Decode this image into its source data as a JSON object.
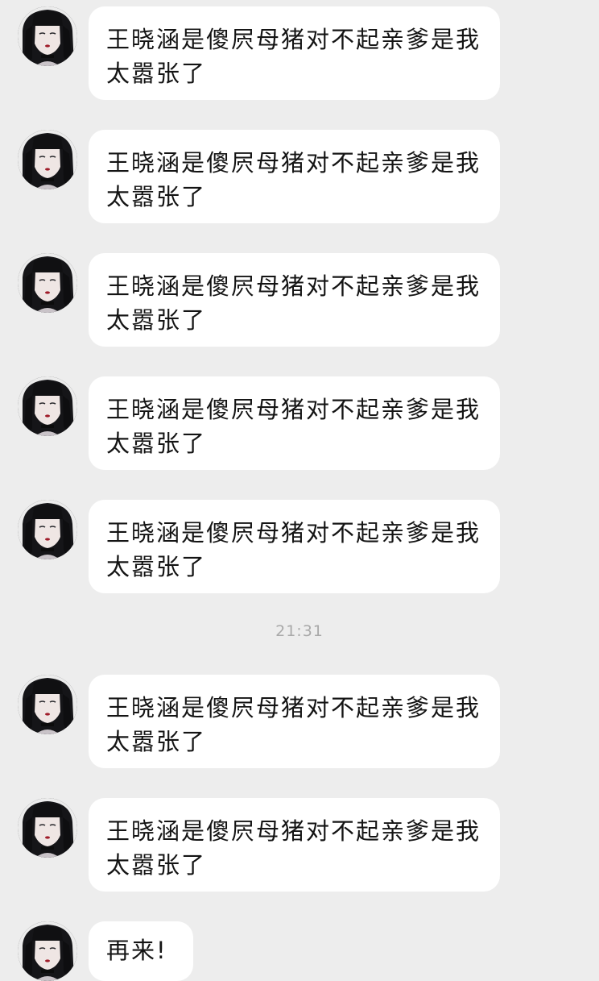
{
  "messages_before": [
    {
      "text": "王晓涵是傻屄母猪对不起亲爹是我太嚣张了"
    },
    {
      "text": "王晓涵是傻屄母猪对不起亲爹是我太嚣张了"
    },
    {
      "text": "王晓涵是傻屄母猪对不起亲爹是我太嚣张了"
    },
    {
      "text": "王晓涵是傻屄母猪对不起亲爹是我太嚣张了"
    },
    {
      "text": "王晓涵是傻屄母猪对不起亲爹是我太嚣张了"
    }
  ],
  "timestamp": "21:31",
  "messages_after": [
    {
      "text": "王晓涵是傻屄母猪对不起亲爹是我太嚣张了"
    },
    {
      "text": "王晓涵是傻屄母猪对不起亲爹是我太嚣张了"
    },
    {
      "text": "再来!"
    }
  ],
  "colors": {
    "background": "#ededed",
    "bubble": "#ffffff",
    "text": "#141414",
    "timestamp": "#a9a9a9"
  }
}
